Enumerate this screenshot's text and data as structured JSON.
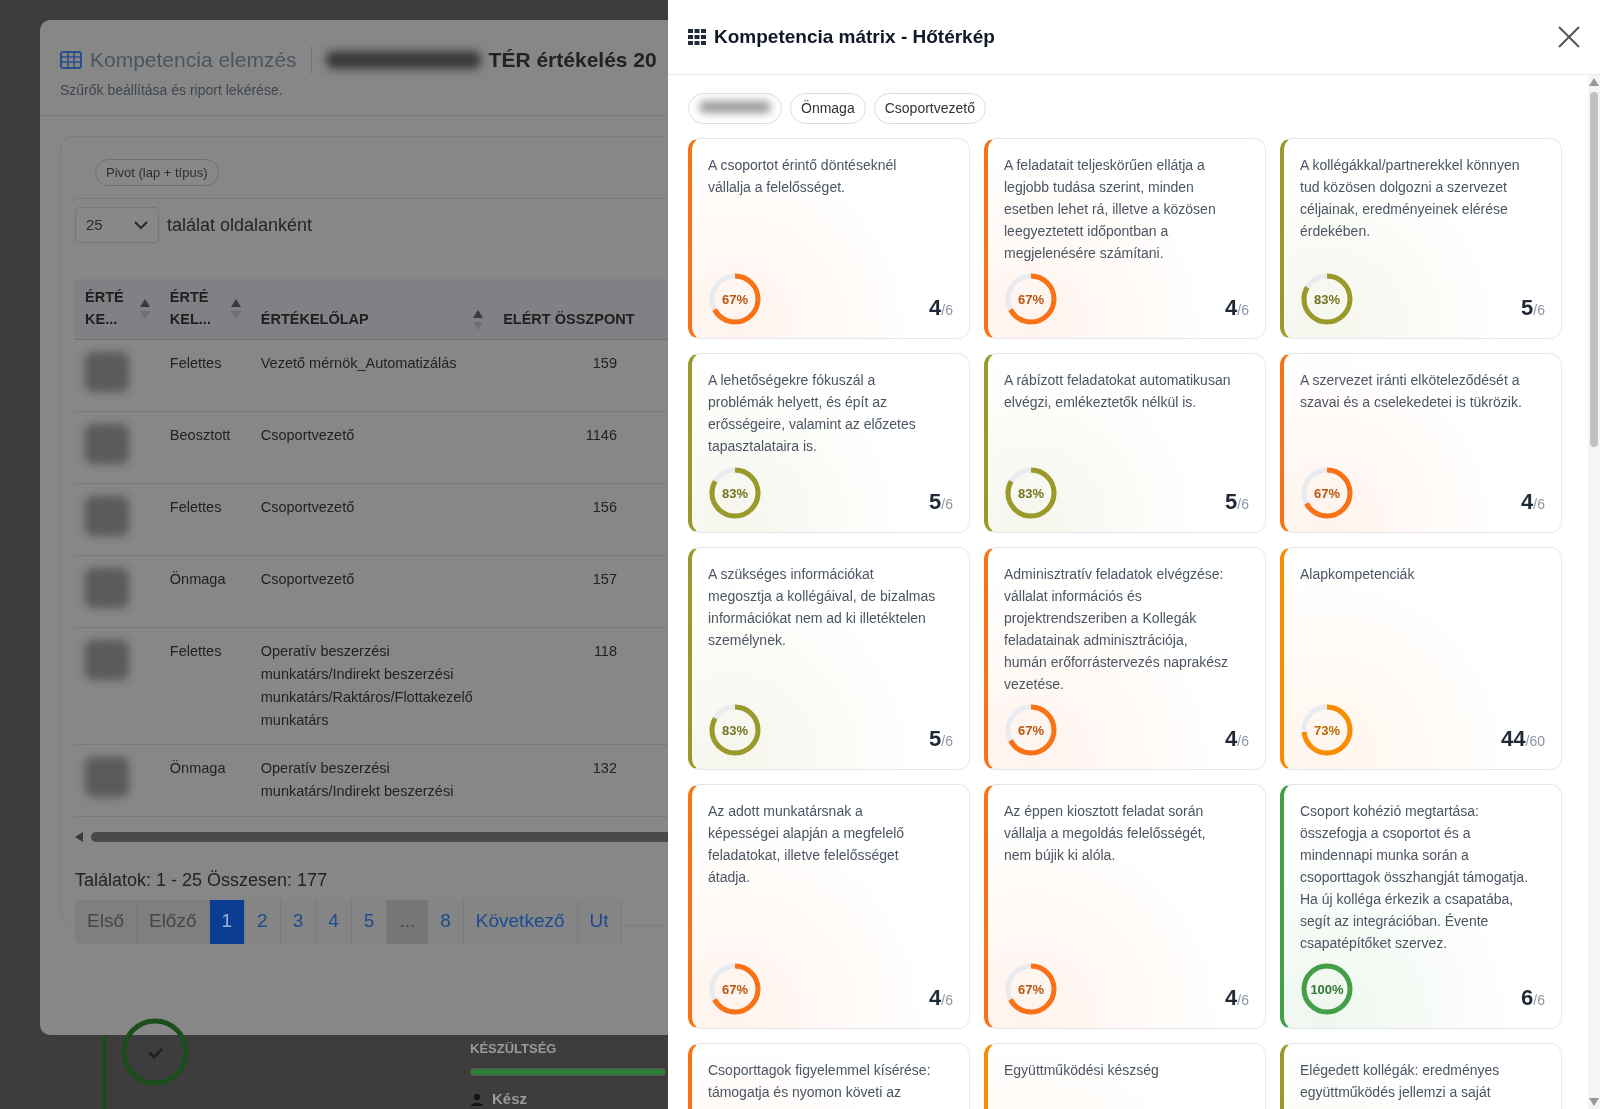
{
  "background": {
    "section_label": "KÉSZÜLTSÉG",
    "progress": {
      "level": 1
    },
    "status": "Kész"
  },
  "modal": {
    "title": "Kompetencia elemzés",
    "report_title": "TÉR értékelés 20",
    "subtitle": "Szűrők beállítása és riport lekérése.",
    "pivot_button": "Pivot (lap + típus)",
    "page_size": "25",
    "page_size_label": "találat oldalanként",
    "table": {
      "columns": [
        "ÉRTÉ KE...",
        "ÉRTÉ KEL...",
        "ÉRTÉKELŐLAP",
        "ELÉRT ÖSSZPONT"
      ],
      "rows": [
        {
          "cells": [
            "",
            "Felettes",
            "Vezető mérnök_Automatizálás",
            "159"
          ]
        },
        {
          "cells": [
            "",
            "Beosztott",
            "Csoportvezető",
            "1146"
          ]
        },
        {
          "cells": [
            "",
            "Felettes",
            "Csoportvezető",
            "156"
          ]
        },
        {
          "cells": [
            "",
            "Önmaga",
            "Csoportvezető",
            "157"
          ]
        },
        {
          "cells": [
            "",
            "Felettes",
            "Operatív beszerzési munkatárs/Indirekt beszerzési munkatárs/Raktáros/Flottakezelő munkatárs",
            "118"
          ]
        },
        {
          "cells": [
            "",
            "Önmaga",
            "Operatív beszerzési munkatárs/Indirekt beszerzési",
            "132"
          ]
        }
      ]
    },
    "results": "Találatok: 1 - 25 Összesen: 177",
    "pagination": [
      {
        "label": "Első",
        "kind": "nav",
        "selected": false,
        "disabled": true
      },
      {
        "label": "Előző",
        "kind": "nav",
        "selected": false,
        "disabled": true
      },
      {
        "label": "1",
        "kind": "page",
        "selected": true,
        "disabled": false
      },
      {
        "label": "2",
        "kind": "page",
        "selected": false,
        "disabled": false
      },
      {
        "label": "3",
        "kind": "page",
        "selected": false,
        "disabled": false
      },
      {
        "label": "4",
        "kind": "page",
        "selected": false,
        "disabled": false
      },
      {
        "label": "5",
        "kind": "page",
        "selected": false,
        "disabled": false
      },
      {
        "label": "...",
        "kind": "ellipsis",
        "selected": false,
        "disabled": true
      },
      {
        "label": "8",
        "kind": "page",
        "selected": false,
        "disabled": false
      },
      {
        "label": "Következő",
        "kind": "nav",
        "selected": false,
        "disabled": false
      },
      {
        "label": "Ut",
        "kind": "nav",
        "selected": false,
        "disabled": false
      }
    ]
  },
  "panel": {
    "title": "Kompetencia mátrix - Hőtérkép",
    "chips": [
      "Önmaga",
      "Csoportvezető"
    ],
    "cards": [
      {
        "text": "A csoportot érintő döntéseknél vállalja a felelősséget.",
        "color": "#f97316",
        "level": 0.67,
        "percent": "67%",
        "score": "4",
        "total": "/6"
      },
      {
        "text": "A feladatait teljeskörűen ellátja a legjobb tudása szerint, minden esetben lehet rá, illetve a közösen leegyeztetett időpontban a megjelenésére számítani.",
        "color": "#f97316",
        "level": 0.67,
        "percent": "67%",
        "score": "4",
        "total": "/6"
      },
      {
        "text": "A kollégákkal/partnerekkel könnyen tud közösen dolgozni a szervezet céljainak, eredményeinek elérése érdekében.",
        "color": "#9a9a2a",
        "level": 0.83,
        "percent": "83%",
        "score": "5",
        "total": "/6"
      },
      {
        "text": "A lehetőségekre fókuszál a problémák helyett, és épít az erősségeire, valamint az előzetes tapasztalataira is.",
        "color": "#9a9a2a",
        "level": 0.83,
        "percent": "83%",
        "score": "5",
        "total": "/6"
      },
      {
        "text": "A rábízott feladatokat automatikusan elvégzi, emlékeztetők nélkül is.",
        "color": "#9a9a2a",
        "level": 0.83,
        "percent": "83%",
        "score": "5",
        "total": "/6"
      },
      {
        "text": "A szervezet iránti elköteleződését a szavai és a cselekedetei is tükrözik.",
        "color": "#f97316",
        "level": 0.67,
        "percent": "67%",
        "score": "4",
        "total": "/6"
      },
      {
        "text": "A szükséges információkat megosztja a kollégáival, de bizalmas információkat nem ad ki illetéktelen személynek.",
        "color": "#9a9a2a",
        "level": 0.83,
        "percent": "83%",
        "score": "5",
        "total": "/6"
      },
      {
        "text": "Adminisztratív feladatok elvégzése: vállalat információs és projektrendszeriben a Kollegák feladatainak adminisztrációja, humán erőforrástervezés naprakész vezetése.",
        "color": "#f97316",
        "level": 0.67,
        "percent": "67%",
        "score": "4",
        "total": "/6"
      },
      {
        "text": "Alapkompetenciák",
        "color": "#fb8c00",
        "level": 0.73,
        "percent": "73%",
        "score": "44",
        "total": "/60"
      },
      {
        "text": "Az adott munkatársnak a képességei alapján a megfelelő feladatokat, illetve felelősséget átadja.",
        "color": "#f97316",
        "level": 0.67,
        "percent": "67%",
        "score": "4",
        "total": "/6"
      },
      {
        "text": "Az éppen kiosztott feladat során vállalja a megoldás felelősségét, nem bújik ki alóla.",
        "color": "#f97316",
        "level": 0.67,
        "percent": "67%",
        "score": "4",
        "total": "/6"
      },
      {
        "text": "Csoport kohézió megtartása: összefogja a csoportot és a mindennapi munka során a csoporttagok összhangját támogatja. Ha új kolléga érkezik a csapatába, segít az integrációban. Évente csapatépítőket szervez.",
        "color": "#43a047",
        "level": 1,
        "percent": "100%",
        "score": "6",
        "total": "/6"
      },
      {
        "text": "Csoporttagok figyelemmel kísérése: támogatja és nyomon követi az",
        "color": "#f97316"
      },
      {
        "text": "Együttműködési készség",
        "color": "#fb8c00"
      },
      {
        "text": "Elégedett kollégák: eredményes együttműködés jellemzi a saját",
        "color": "#9a9a2a"
      }
    ]
  }
}
